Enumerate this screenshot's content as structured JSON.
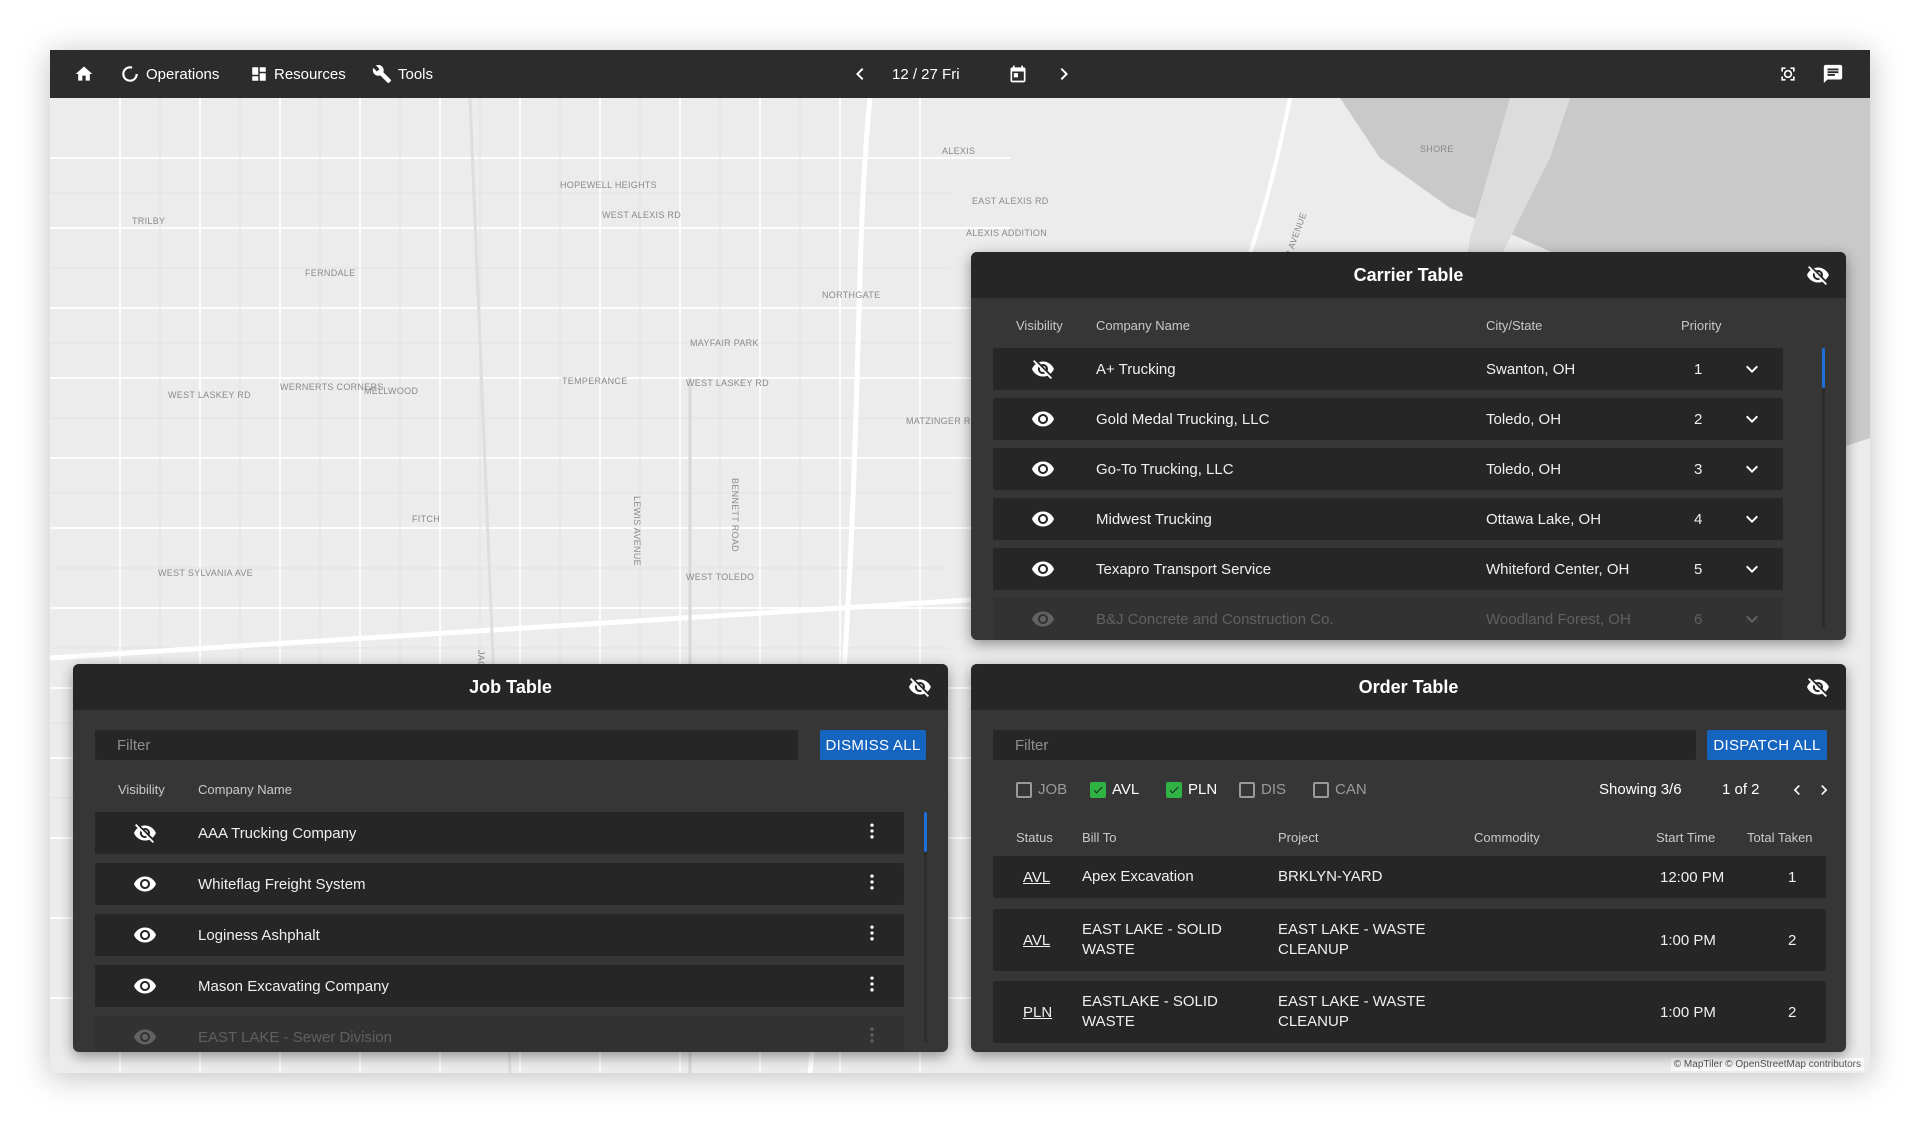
{
  "nav": {
    "operations": "Operations",
    "resources": "Resources",
    "tools": "Tools",
    "date": "12 / 27 Fri"
  },
  "map": {
    "labels": [
      "TRILBY",
      "HOPEWELL HEIGHTS",
      "WEST ALEXIS RD",
      "EAST ALEXIS RD",
      "ALEXIS ADDITION",
      "ALEXIS",
      "FERNDALE",
      "NORTHGATE",
      "MAYFAIR PARK",
      "WEST LASKEY RD",
      "WERNERTS CORNERS",
      "MELLWOOD",
      "TEMPERANCE",
      "WEST LASKEY RD",
      "MATZINGER R",
      "LEWIS AVENUE",
      "BENNETT ROAD",
      "FITCH",
      "WEST SYLVANIA AVE",
      "WEST TOLEDO",
      "JACKMAN ROAD",
      "SUDER AVENUE",
      "SHORE"
    ],
    "attribution": "© MapTiler © OpenStreetMap contributors"
  },
  "carrier_table": {
    "title": "Carrier Table",
    "columns": {
      "visibility": "Visibility",
      "company": "Company Name",
      "city": "City/State",
      "priority": "Priority"
    },
    "rows": [
      {
        "company": "A+ Trucking",
        "city": "Swanton, OH",
        "priority": "1",
        "visible": false
      },
      {
        "company": "Gold Medal Trucking, LLC",
        "city": "Toledo, OH",
        "priority": "2",
        "visible": true
      },
      {
        "company": "Go-To Trucking, LLC",
        "city": "Toledo, OH",
        "priority": "3",
        "visible": true
      },
      {
        "company": "Midwest Trucking",
        "city": "Ottawa Lake, OH",
        "priority": "4",
        "visible": true
      },
      {
        "company": "Texapro Transport Service",
        "city": "Whiteford Center, OH",
        "priority": "5",
        "visible": true
      },
      {
        "company": "B&J Concrete and Construction Co.",
        "city": "Woodland Forest, OH",
        "priority": "6",
        "visible": true
      }
    ]
  },
  "job_table": {
    "title": "Job Table",
    "filter_placeholder": "Filter",
    "dismiss_label": "DISMISS ALL",
    "columns": {
      "visibility": "Visibility",
      "company": "Company Name"
    },
    "rows": [
      {
        "company": "AAA Trucking Company",
        "visible": false
      },
      {
        "company": "Whiteflag Freight System",
        "visible": true
      },
      {
        "company": "Loginess Ashphalt",
        "visible": true
      },
      {
        "company": "Mason Excavating Company",
        "visible": true
      },
      {
        "company": "EAST LAKE - Sewer Division",
        "visible": true
      }
    ]
  },
  "order_table": {
    "title": "Order Table",
    "filter_placeholder": "Filter",
    "dispatch_label": "DISPATCH ALL",
    "filters": [
      {
        "label": "JOB",
        "checked": false
      },
      {
        "label": "AVL",
        "checked": true
      },
      {
        "label": "PLN",
        "checked": true
      },
      {
        "label": "DIS",
        "checked": false
      },
      {
        "label": "CAN",
        "checked": false
      }
    ],
    "showing": "Showing  3/6",
    "page": "1 of 2",
    "columns": {
      "status": "Status",
      "bill_to": "Bill To",
      "project": "Project",
      "commodity": "Commodity",
      "start_time": "Start Time",
      "total_taken": "Total Taken"
    },
    "rows": [
      {
        "status": "AVL",
        "bill_to_1": "Apex Excavation",
        "bill_to_2": "",
        "project_1": "BRKLYN-YARD",
        "project_2": "",
        "commodity": "",
        "start_time": "12:00 PM",
        "total": "1"
      },
      {
        "status": "AVL",
        "bill_to_1": "EAST LAKE - SOLID",
        "bill_to_2": "WASTE",
        "project_1": "EAST LAKE - WASTE",
        "project_2": "CLEANUP",
        "commodity": "",
        "start_time": "1:00 PM",
        "total": "2"
      },
      {
        "status": "PLN",
        "bill_to_1": "EASTLAKE - SOLID",
        "bill_to_2": "WASTE",
        "project_1": "EAST LAKE - WASTE",
        "project_2": "CLEANUP",
        "commodity": "",
        "start_time": "1:00 PM",
        "total": "2"
      }
    ]
  },
  "colors": {
    "accent": "#1565c0",
    "check": "#2fb344",
    "panel": "#363636",
    "row": "#262626",
    "topbar": "#2c2c2c"
  },
  "icons": [
    "home-icon",
    "operations-icon",
    "resources-icon",
    "tools-icon",
    "chevron-left-icon",
    "calendar-icon",
    "chevron-right-icon",
    "focus-icon",
    "chat-icon",
    "eye-icon",
    "eye-off-icon",
    "chevron-down-icon",
    "more-vert-icon"
  ]
}
